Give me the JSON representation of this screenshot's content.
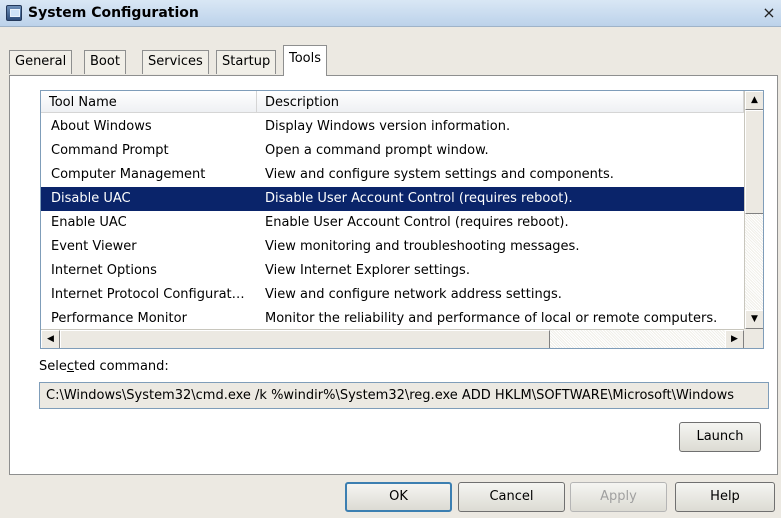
{
  "window": {
    "title": "System Configuration",
    "close_glyph": "×"
  },
  "tabs": [
    {
      "label": "General"
    },
    {
      "label": "Boot"
    },
    {
      "label": "Services"
    },
    {
      "label": "Startup"
    },
    {
      "label": "Tools",
      "active": true
    }
  ],
  "listview": {
    "columns": [
      "Tool Name",
      "Description"
    ],
    "rows": [
      {
        "name": "About Windows",
        "desc": "Display Windows version information."
      },
      {
        "name": "Command Prompt",
        "desc": "Open a command prompt window."
      },
      {
        "name": "Computer Management",
        "desc": "View and configure system settings and components."
      },
      {
        "name": "Disable UAC",
        "desc": "Disable User Account Control (requires reboot).",
        "selected": true
      },
      {
        "name": "Enable UAC",
        "desc": "Enable User Account Control (requires reboot)."
      },
      {
        "name": "Event Viewer",
        "desc": "View monitoring and troubleshooting messages."
      },
      {
        "name": "Internet Options",
        "desc": "View Internet Explorer settings."
      },
      {
        "name": "Internet Protocol Configurat…",
        "desc": "View and configure network address settings."
      },
      {
        "name": "Performance Monitor",
        "desc": "Monitor the reliability and performance of local or remote computers."
      }
    ]
  },
  "selected_command": {
    "label": "Selected command:",
    "label_accesskey": "c",
    "value": "C:\\Windows\\System32\\cmd.exe /k %windir%\\System32\\reg.exe ADD HKLM\\SOFTWARE\\Microsoft\\Windows"
  },
  "buttons": {
    "launch": "Launch",
    "ok": "OK",
    "cancel": "Cancel",
    "apply": "Apply",
    "help": "Help"
  },
  "icons": {
    "scroll_up": "▲",
    "scroll_down": "▼",
    "scroll_left": "◀",
    "scroll_right": "▶"
  },
  "colors": {
    "selection": "#0a246a",
    "window_bg": "#ece9e2"
  }
}
